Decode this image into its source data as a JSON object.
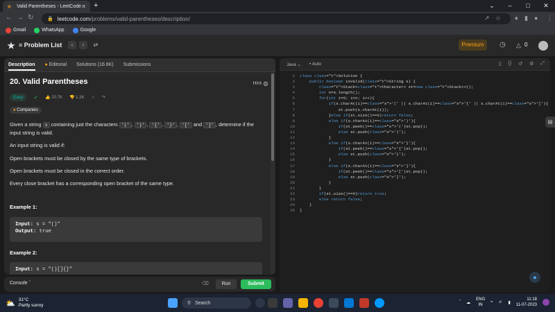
{
  "browser": {
    "tab_title": "Valid Parentheses - LeetCode",
    "new_tab": "+",
    "url_host": "leetcode.com",
    "url_path": "/problems/valid-parentheses/description/",
    "bookmarks": [
      {
        "label": "Gmail",
        "color": "#ea4335"
      },
      {
        "label": "WhatsApp",
        "color": "#25d366"
      },
      {
        "label": "Google",
        "color": "#4285f4"
      }
    ]
  },
  "lc_nav": {
    "problem_list": "Problem List",
    "premium": "Premium",
    "streak": "0"
  },
  "left": {
    "tabs": [
      "Description",
      "Editorial",
      "Solutions (16.6K)",
      "Submissions"
    ],
    "title": "20. Valid Parentheses",
    "hint": "Hint",
    "difficulty": "Easy",
    "likes": "20.7K",
    "dislikes": "1.3K",
    "companies": "Companies",
    "p1_a": "Given a string ",
    "p1_s": "s",
    "p1_b": " containing just the characters ",
    "p1_c1": "'('",
    "p1_c2": "')'",
    "p1_c3": "'{'",
    "p1_c4": "'}'",
    "p1_c5": "'['",
    "p1_and": " and ",
    "p1_c6": "']'",
    "p1_d": ", determine if the input string is valid.",
    "p2": "An input string is valid if:",
    "p3": "Open brackets must be closed by the same type of brackets.",
    "p4": "Open brackets must be closed in the correct order.",
    "p5": "Every close bracket has a corresponding open bracket of the same type.",
    "ex1_h": "Example 1:",
    "ex1_input_label": "Input:",
    "ex1_input": " s = \"()\"",
    "ex1_output_label": "Output:",
    "ex1_output": " true",
    "ex2_h": "Example 2:",
    "ex2_input_label": "Input:",
    "ex2_input": " s = \"()[]{}\""
  },
  "console": {
    "label": "Console",
    "run": "Run",
    "submit": "Submit"
  },
  "editor": {
    "language": "Java",
    "mode": "Auto",
    "lines": [
      "class Solution {",
      "    public boolean isValid(String s) {",
      "        Stack<Character> st=new Stack<>();",
      "        int n=s.length();",
      "        for(int i=0; i<n; i++){",
      "            if(s.charAt(i)=='(' || s.charAt(i)=='{' || s.charAt(i)=='['){",
      "                st.push(s.charAt(i));",
      "            }else if(st.size()==0)return false;",
      "            else if(s.charAt(i)==')'){",
      "                if(st.peek()=='(')st.pop();",
      "                else st.push(')');",
      "            }",
      "            else if(s.charAt(i)=='}'){",
      "                if(st.peek()=='{')st.pop();",
      "                else st.push('}');",
      "            }",
      "            else if(s.charAt(i)==']'){",
      "                if(st.peek()=='[')st.pop();",
      "                else st.push(']');",
      "            }",
      "        }",
      "        if(st.size()==0)return true;",
      "        else return false;",
      "    }",
      "}"
    ]
  },
  "taskbar": {
    "temp": "31°C",
    "weather": "Partly sunny",
    "search": "Search",
    "lang1": "ENG",
    "lang2": "IN",
    "time": "11:18",
    "date": "11-07-2023"
  }
}
